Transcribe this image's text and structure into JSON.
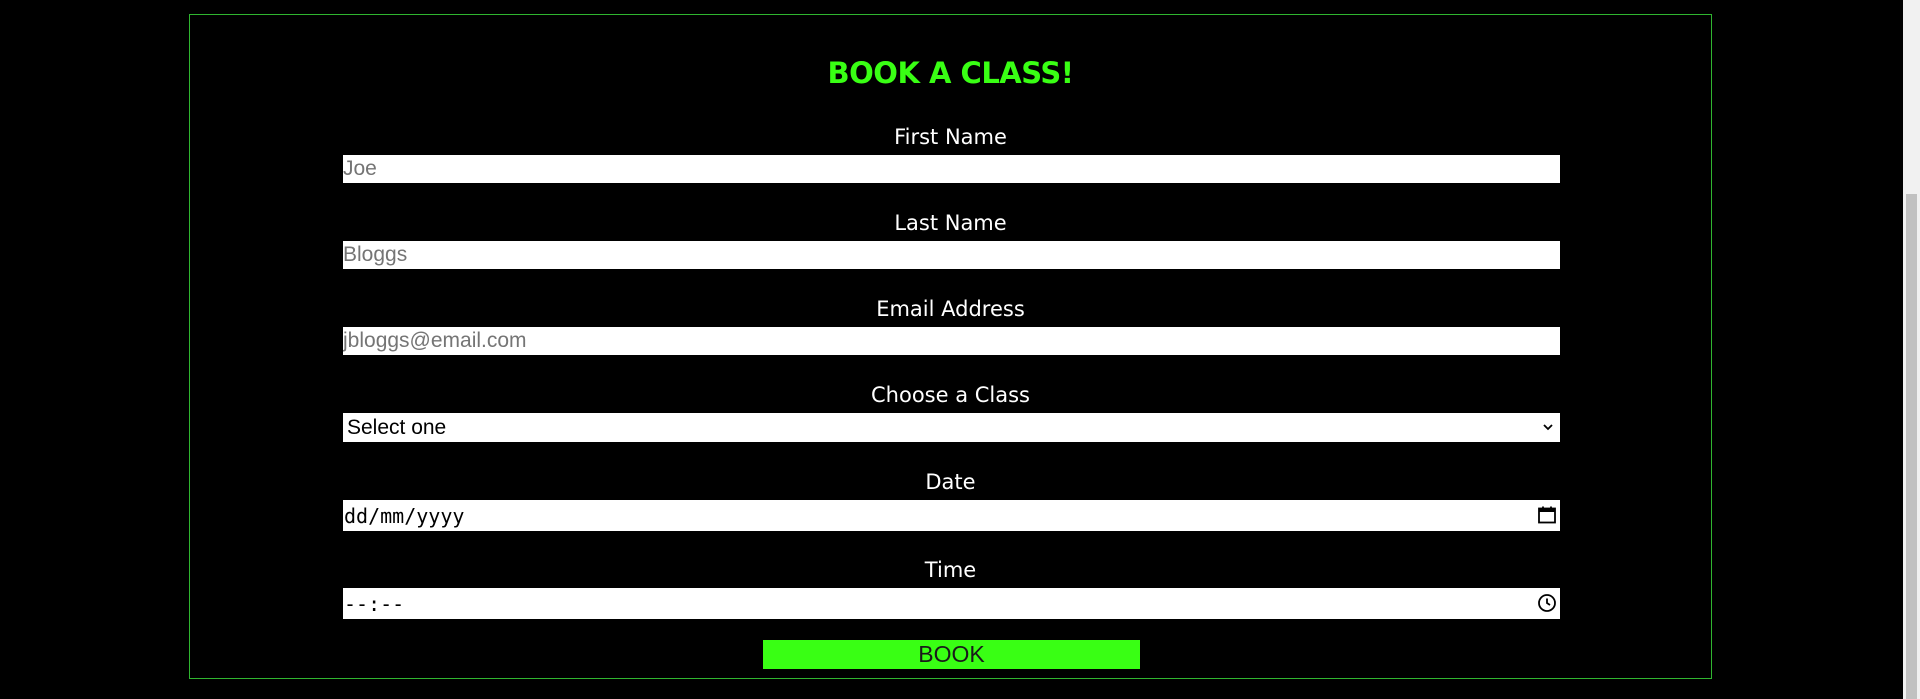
{
  "form": {
    "title": "BOOK A CLASS!",
    "first_name": {
      "label": "First Name",
      "placeholder": "Joe",
      "value": ""
    },
    "last_name": {
      "label": "Last Name",
      "placeholder": "Bloggs",
      "value": ""
    },
    "email": {
      "label": "Email Address",
      "placeholder": "jbloggs@email.com",
      "value": ""
    },
    "class": {
      "label": "Choose a Class",
      "selected": "Select one"
    },
    "date": {
      "label": "Date",
      "display": "dd/mm/yyyy"
    },
    "time": {
      "label": "Time",
      "display": "--:--"
    },
    "submit_label": "BOOK"
  },
  "icons": {
    "select": "chevron-down-icon",
    "date": "calendar-icon",
    "time": "clock-icon"
  },
  "colors": {
    "background": "#000000",
    "accent": "#39ff14",
    "panel_border": "#2fb52f",
    "label_text": "#ffffff",
    "placeholder_text": "#757575"
  }
}
